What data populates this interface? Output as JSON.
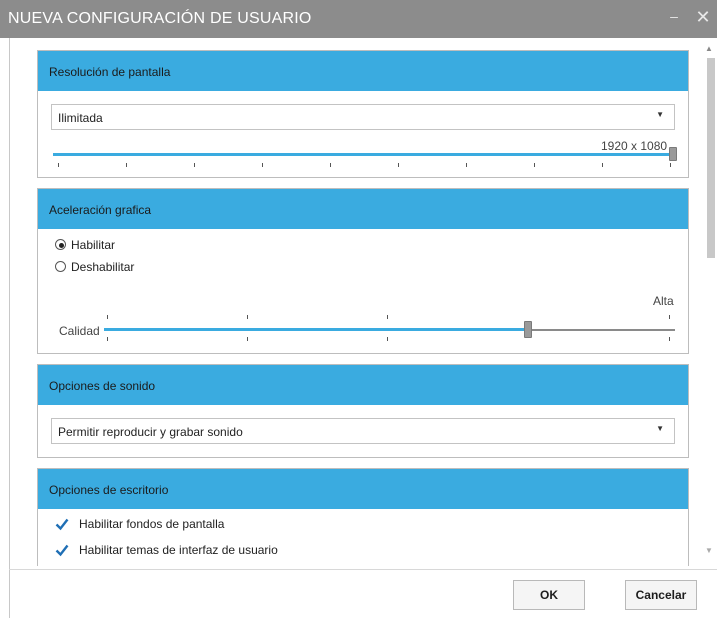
{
  "window": {
    "title": "NUEVA CONFIGURACIÓN DE USUARIO",
    "minimize_glyph": "–",
    "close_glyph": "✕"
  },
  "resolution": {
    "header": "Resolución de pantalla",
    "dropdown_value": "Ilimitada",
    "slider_value_label": "1920 x 1080",
    "slider_level": 1.0
  },
  "graphics": {
    "header": "Aceleración grafica",
    "options": [
      "Habilitar",
      "Deshabilitar"
    ],
    "selected": "Habilitar",
    "slider_min_label": "Calidad",
    "slider_max_label": "Alta",
    "slider_level": 0.75
  },
  "sound": {
    "header": "Opciones de sonido",
    "dropdown_value": "Permitir reproducir y grabar sonido"
  },
  "desktop": {
    "header": "Opciones de escritorio",
    "checkboxes": [
      {
        "label": "Habilitar fondos de pantalla",
        "checked": true
      },
      {
        "label": "Habilitar temas de interfaz de usuario",
        "checked": true
      }
    ]
  },
  "footer": {
    "ok_label": "OK",
    "cancel_label": "Cancelar"
  },
  "colors": {
    "accent": "#3aabe0",
    "titlebar": "#8c8c8c",
    "check": "#1f6fb5"
  },
  "icons": {
    "dropdown_arrow": "chevron-down-icon",
    "check": "checkmark-icon"
  }
}
